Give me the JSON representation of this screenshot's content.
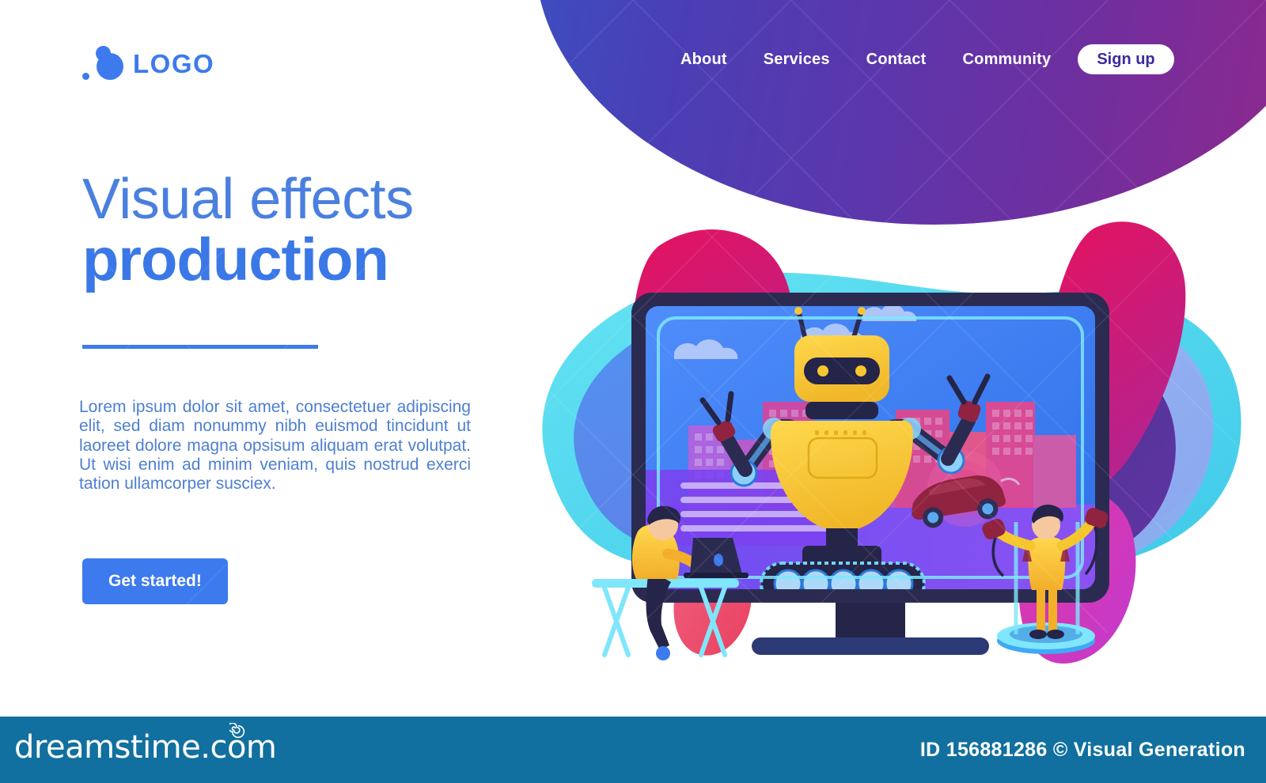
{
  "brand": {
    "logo_text": "LOGO",
    "logo_icon": "two-circles-dot-icon",
    "accent_blue": "#3c7aed",
    "text_blue": "#4d7fd1"
  },
  "nav": {
    "items": [
      {
        "label": "About",
        "name": "nav-about"
      },
      {
        "label": "Services",
        "name": "nav-services"
      },
      {
        "label": "Contact",
        "name": "nav-contact"
      },
      {
        "label": "Community",
        "name": "nav-community"
      }
    ],
    "signup_label": "Sign up",
    "gradient_from": "#3a52c4",
    "gradient_to": "#96268a"
  },
  "hero": {
    "title_light": "Visual effects",
    "title_bold": "production",
    "body": "Lorem ipsum dolor sit amet, consectetuer adipiscing elit, sed diam nonummy nibh euismod tincidunt ut laoreet dolore magna opsisum aliquam erat volutpat. Ut wisi enim ad minim veniam, quis nostrud exerci tation ullamcorper susciex.",
    "cta_label": "Get started!"
  },
  "illustration": {
    "alt": "robot on treads inside a monitor with city backdrop, a developer at a laptop and a person with VR controllers",
    "monitor_bezel_color": "#2b2b52",
    "screen_sky_color": "#3f7ff0",
    "robot_body_color": "#f6c62e",
    "robot_visor_color": "#252449",
    "treads_color": "#2c2c55",
    "city_color": "#d94a9e",
    "car_color": "#8f2340",
    "person_shirt_color": "#f6c62e",
    "platform_color": "#3fa9f5"
  },
  "footer": {
    "site": "dreamstime.com",
    "spiral_icon": "spiral-icon",
    "credit": "ID 156881286 © Visual Generation",
    "bar_color": "#11709f"
  }
}
